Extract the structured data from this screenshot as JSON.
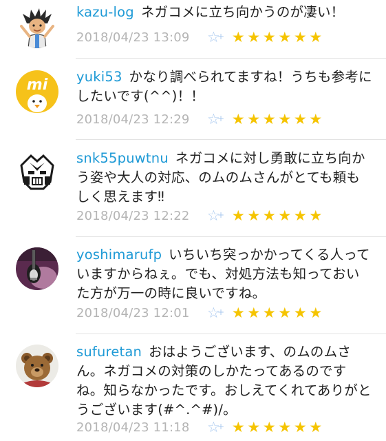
{
  "comments": [
    {
      "username": "kazu-log",
      "text": "ネガコメに立ち向かうのが凄い！",
      "timestamp": "2018/04/23 13:09",
      "star_count": 6,
      "avatar_icon": "cartoon-character-avatar"
    },
    {
      "username": "yuki53",
      "text": "かなり調べられてますね！うちも参考にしたいです(^^)！！",
      "timestamp": "2018/04/23 12:29",
      "star_count": 6,
      "avatar_icon": "yellow-mi-chick-avatar",
      "avatar_text": "mi"
    },
    {
      "username": "snk55puwtnu",
      "text": "ネガコメに対し勇敢に立ち向かう姿や大人の対応、のムのムさんがとても頼もしく思えます‼",
      "timestamp": "2018/04/23 12:22",
      "star_count": 6,
      "avatar_icon": "robot-head-avatar"
    },
    {
      "username": "yoshimarufp",
      "text": "いちいち突っかかってくる人っていますからねぇ。でも、対処方法も知っておいた方が万一の時に良いですね。",
      "timestamp": "2018/04/23 12:01",
      "star_count": 6,
      "avatar_icon": "guitar-photo-avatar"
    },
    {
      "username": "sufuretan",
      "text": "おはようございます、のムのムさん。ネガコメの対策のしかたってあるのですね。知らなかったです。おしえてくれてありがとうございます(#^.^#)/。",
      "timestamp": "2018/04/23 11:18",
      "star_count": 6,
      "avatar_icon": "teddy-bear-photo-avatar"
    }
  ],
  "colors": {
    "username": "#1e9ad6",
    "timestamp": "#b5b5b5",
    "star": "#f5c400",
    "add_star": "#a8c8ef",
    "divider": "#e3e3e3"
  }
}
